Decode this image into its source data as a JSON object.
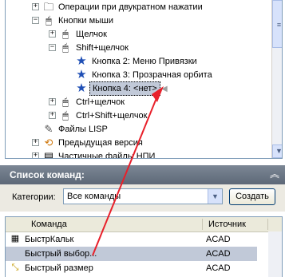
{
  "tree": {
    "items": [
      {
        "label": "Операции при двукратном нажатии",
        "toggle": "+"
      },
      {
        "label": "Кнопки мыши",
        "toggle": "−"
      },
      {
        "label": "Щелчок",
        "toggle": "+"
      },
      {
        "label": "Shift+щелчок",
        "toggle": "−"
      },
      {
        "label": "Кнопка 2: Меню Привязки"
      },
      {
        "label": "Кнопка 3: Прозрачная орбита"
      },
      {
        "label": "Кнопка 4: <нет>"
      },
      {
        "label": "Ctrl+щелчок",
        "toggle": "+"
      },
      {
        "label": "Ctrl+Shift+щелчок",
        "toggle": "+"
      },
      {
        "label": "Файлы LISP"
      },
      {
        "label": "Предыдущая версия",
        "toggle": "+"
      },
      {
        "label": "Частичные файлы НПИ",
        "toggle": "+"
      }
    ]
  },
  "panel": {
    "title": "Список команд:",
    "category_label": "Категории:",
    "category_value": "Все команды",
    "create_button": "Создать"
  },
  "list": {
    "columns": [
      "Команда",
      "Источник"
    ],
    "rows": [
      {
        "command": "БыстрКальк",
        "source": "ACAD"
      },
      {
        "command": "Быстрый выбор...",
        "source": "ACAD"
      },
      {
        "command": "Быстрый размер",
        "source": "ACAD"
      }
    ]
  },
  "colors": {
    "arrow": "#e8202a",
    "selected": "#c1c9d8",
    "header": "#6b7686"
  }
}
